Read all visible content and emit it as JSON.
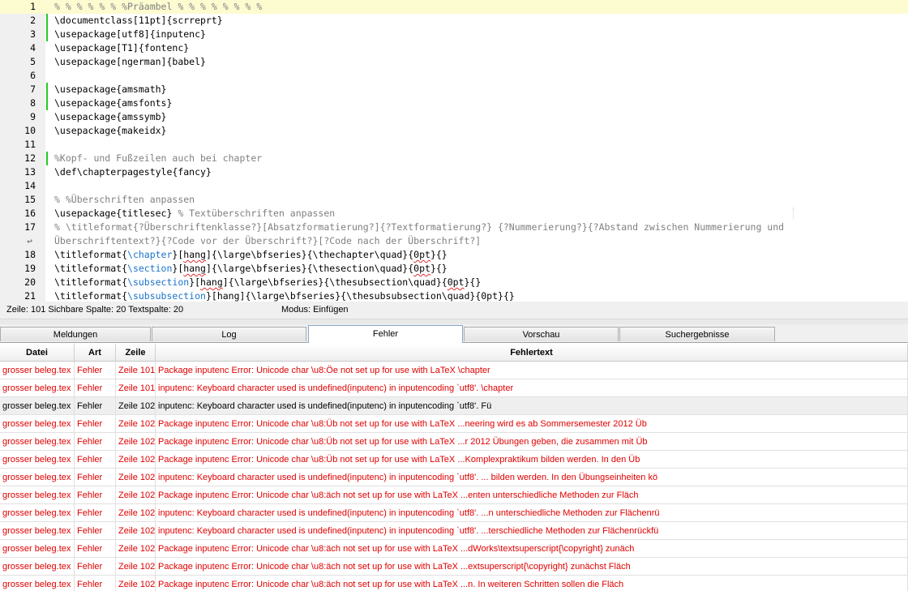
{
  "editor": {
    "lines": [
      {
        "num": "1",
        "segments": [
          {
            "t": "% % % % % % %Präambel % % % % % % % %",
            "c": "cmt"
          }
        ],
        "mark": false,
        "highlight": true
      },
      {
        "num": "2",
        "segments": [
          {
            "t": "\\documentclass[11pt]{scrreprt}",
            "c": "cmd"
          }
        ],
        "mark": true
      },
      {
        "num": "3",
        "segments": [
          {
            "t": "\\usepackage[utf8]{inputenc}",
            "c": "cmd"
          }
        ],
        "mark": true
      },
      {
        "num": "4",
        "segments": [
          {
            "t": "\\usepackage[T1]{fontenc}",
            "c": "cmd"
          }
        ],
        "mark": false
      },
      {
        "num": "5",
        "segments": [
          {
            "t": "\\usepackage[ngerman]{babel}",
            "c": "cmd"
          }
        ],
        "mark": false
      },
      {
        "num": "6",
        "segments": [],
        "mark": false
      },
      {
        "num": "7",
        "segments": [
          {
            "t": "\\usepackage{amsmath}",
            "c": "cmd"
          }
        ],
        "mark": true
      },
      {
        "num": "8",
        "segments": [
          {
            "t": "\\usepackage{amsfonts}",
            "c": "cmd"
          }
        ],
        "mark": true
      },
      {
        "num": "9",
        "segments": [
          {
            "t": "\\usepackage{amssymb}",
            "c": "cmd"
          }
        ],
        "mark": false
      },
      {
        "num": "10",
        "segments": [
          {
            "t": "\\usepackage{makeidx}",
            "c": "cmd"
          }
        ],
        "mark": false
      },
      {
        "num": "11",
        "segments": [],
        "mark": false
      },
      {
        "num": "12",
        "segments": [
          {
            "t": "%Kopf- und Fußzeilen auch bei chapter",
            "c": "cmt"
          }
        ],
        "mark": true
      },
      {
        "num": "13",
        "segments": [
          {
            "t": "\\def\\chapterpagestyle{fancy}",
            "c": "cmd"
          }
        ],
        "mark": false
      },
      {
        "num": "14",
        "segments": [],
        "mark": false
      },
      {
        "num": "15",
        "segments": [
          {
            "t": "% %Überschriften anpassen",
            "c": "cmt"
          }
        ],
        "mark": false
      },
      {
        "num": "16",
        "segments": [
          {
            "t": "\\usepackage{titlesec} ",
            "c": "cmd"
          },
          {
            "t": "% Textüberschriften anpassen",
            "c": "cmt"
          }
        ],
        "mark": false
      },
      {
        "num": "17",
        "segments": [
          {
            "t": "% \\titleformat{?Überschriftenklasse?}[Absatzformatierung?]{?Textformatierung?} {?Nummerierung?}{?Abstand zwischen Nummerierung und",
            "c": "cmt"
          }
        ],
        "mark": false
      },
      {
        "num": "",
        "wrap": true,
        "segments": [
          {
            "t": "Überschriftentext?}{?Code vor der Überschrift?}[?Code nach der Überschrift?]",
            "c": "cmt"
          }
        ],
        "mark": false
      },
      {
        "num": "18",
        "segments": [
          {
            "t": "\\titleformat{",
            "c": "cmd"
          },
          {
            "t": "\\chapter",
            "c": "sec"
          },
          {
            "t": "}[",
            "c": "cmd"
          },
          {
            "t": "hang",
            "c": "sq"
          },
          {
            "t": "]{\\large\\bfseries}{\\thechapter\\quad}{",
            "c": "cmd"
          },
          {
            "t": "0pt",
            "c": "sq"
          },
          {
            "t": "}{}",
            "c": "cmd"
          }
        ],
        "mark": false
      },
      {
        "num": "19",
        "segments": [
          {
            "t": "\\titleformat{",
            "c": "cmd"
          },
          {
            "t": "\\section",
            "c": "sec"
          },
          {
            "t": "}[",
            "c": "cmd"
          },
          {
            "t": "hang",
            "c": "sq"
          },
          {
            "t": "]{\\large\\bfseries}{\\thesection\\quad}{",
            "c": "cmd"
          },
          {
            "t": "0pt",
            "c": "sq"
          },
          {
            "t": "}{}",
            "c": "cmd"
          }
        ],
        "mark": false
      },
      {
        "num": "20",
        "segments": [
          {
            "t": "\\titleformat{",
            "c": "cmd"
          },
          {
            "t": "\\subsection",
            "c": "sec"
          },
          {
            "t": "}[",
            "c": "cmd"
          },
          {
            "t": "hang",
            "c": "sq"
          },
          {
            "t": "]{\\large\\bfseries}{\\thesubsection\\quad}{",
            "c": "cmd"
          },
          {
            "t": "0pt",
            "c": "sq"
          },
          {
            "t": "}{}",
            "c": "cmd"
          }
        ],
        "mark": false
      },
      {
        "num": "21",
        "segments": [
          {
            "t": "\\titleformat{",
            "c": "cmd"
          },
          {
            "t": "\\subsubsection",
            "c": "sec"
          },
          {
            "t": "}[",
            "c": "cmd"
          },
          {
            "t": "hang",
            "c": "sq"
          },
          {
            "t": "]{\\large\\bfseries}{\\thesubsubsection\\quad}{",
            "c": "cmd"
          },
          {
            "t": "0pt",
            "c": "sq"
          },
          {
            "t": "}{}",
            "c": "cmd"
          }
        ],
        "mark": false
      }
    ]
  },
  "status": {
    "position": "Zeile: 101 Sichbare Spalte: 20 Textspalte: 20",
    "mode": "Modus: Einfügen"
  },
  "tabs": [
    {
      "label": "Meldungen",
      "active": false
    },
    {
      "label": "Log",
      "active": false
    },
    {
      "label": "Fehler",
      "active": true
    },
    {
      "label": "Vorschau",
      "active": false
    },
    {
      "label": "Suchergebnisse",
      "active": false
    }
  ],
  "errors": {
    "headers": {
      "file": "Datei",
      "type": "Art",
      "line": "Zeile",
      "text": "Fehlertext"
    },
    "rows": [
      {
        "file": "grosser beleg.tex",
        "type": "Fehler",
        "line": "Zeile 101",
        "text": "Package inputenc Error: Unicode char \\u8:Öe not set up for use with LaTeX \\chapter",
        "selected": false
      },
      {
        "file": "grosser beleg.tex",
        "type": "Fehler",
        "line": "Zeile 101",
        "text": "inputenc: Keyboard character used is undefined(inputenc) in inputencoding `utf8'. \\chapter",
        "selected": false
      },
      {
        "file": "grosser beleg.tex",
        "type": "Fehler",
        "line": "Zeile 102",
        "text": "inputenc: Keyboard character used is undefined(inputenc) in inputencoding `utf8'. Fü",
        "selected": true
      },
      {
        "file": "grosser beleg.tex",
        "type": "Fehler",
        "line": "Zeile 102",
        "text": "Package inputenc Error: Unicode char \\u8:Üb not set up for use with LaTeX ...neering wird es ab Sommersemester 2012 Üb",
        "selected": false
      },
      {
        "file": "grosser beleg.tex",
        "type": "Fehler",
        "line": "Zeile 102",
        "text": "Package inputenc Error: Unicode char \\u8:Üb not set up for use with LaTeX ...r 2012 Übungen geben, die zusammen mit Üb",
        "selected": false
      },
      {
        "file": "grosser beleg.tex",
        "type": "Fehler",
        "line": "Zeile 102",
        "text": "Package inputenc Error: Unicode char \\u8:Üb not set up for use with LaTeX ...Komplexpraktikum bilden werden. In den Üb",
        "selected": false
      },
      {
        "file": "grosser beleg.tex",
        "type": "Fehler",
        "line": "Zeile 102",
        "text": "inputenc: Keyboard character used is undefined(inputenc) in inputencoding `utf8'. ... bilden werden. In den Übungseinheiten kö",
        "selected": false
      },
      {
        "file": "grosser beleg.tex",
        "type": "Fehler",
        "line": "Zeile 102",
        "text": "Package inputenc Error: Unicode char \\u8:äch not set up for use with LaTeX ...enten unterschiedliche Methoden zur Fläch",
        "selected": false
      },
      {
        "file": "grosser beleg.tex",
        "type": "Fehler",
        "line": "Zeile 102",
        "text": "inputenc: Keyboard character used is undefined(inputenc) in inputencoding `utf8'. ...n unterschiedliche Methoden zur Flächenrü",
        "selected": false
      },
      {
        "file": "grosser beleg.tex",
        "type": "Fehler",
        "line": "Zeile 102",
        "text": "inputenc: Keyboard character used is undefined(inputenc) in inputencoding `utf8'. ...terschiedliche Methoden zur Flächenrückfü",
        "selected": false
      },
      {
        "file": "grosser beleg.tex",
        "type": "Fehler",
        "line": "Zeile 102",
        "text": "Package inputenc Error: Unicode char \\u8:äch not set up for use with LaTeX ...dWorks\\textsuperscript{\\copyright} zunäch",
        "selected": false
      },
      {
        "file": "grosser beleg.tex",
        "type": "Fehler",
        "line": "Zeile 102",
        "text": "Package inputenc Error: Unicode char \\u8:äch not set up for use with LaTeX ...extsuperscript{\\copyright} zunächst Fläch",
        "selected": false
      },
      {
        "file": "grosser beleg.tex",
        "type": "Fehler",
        "line": "Zeile 102",
        "text": "Package inputenc Error: Unicode char \\u8:äch not set up for use with LaTeX ...n. In weiteren Schritten sollen die Fläch",
        "selected": false
      }
    ]
  }
}
